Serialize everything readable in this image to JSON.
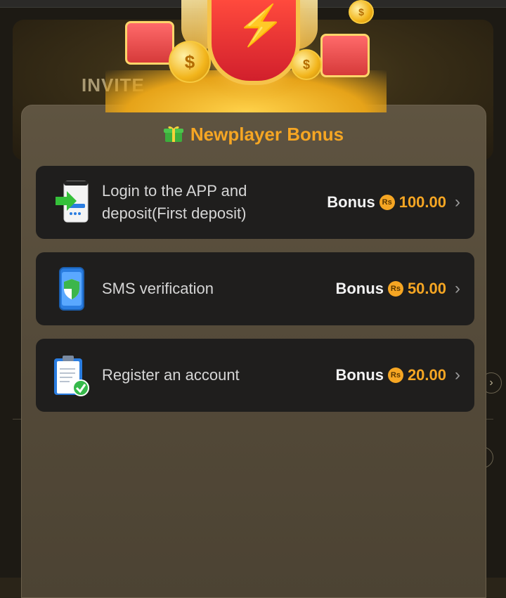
{
  "background": {
    "banner_text": "INVITE"
  },
  "modal": {
    "title": "Newplayer Bonus",
    "title_icon": "gift-icon",
    "tasks": [
      {
        "label": "Login to the APP and deposit(First deposit)",
        "bonus_label": "Bonus",
        "currency_badge": "Rs",
        "amount": "100.00",
        "icon": "phone-login-icon"
      },
      {
        "label": "SMS verification",
        "bonus_label": "Bonus",
        "currency_badge": "Rs",
        "amount": "50.00",
        "icon": "phone-shield-icon"
      },
      {
        "label": "Register an account",
        "bonus_label": "Bonus",
        "currency_badge": "Rs",
        "amount": "20.00",
        "icon": "clipboard-check-icon"
      }
    ]
  },
  "colors": {
    "accent": "#f6a623",
    "modal_bg": "#5a4f3d",
    "card_bg": "#1f1e1d"
  }
}
